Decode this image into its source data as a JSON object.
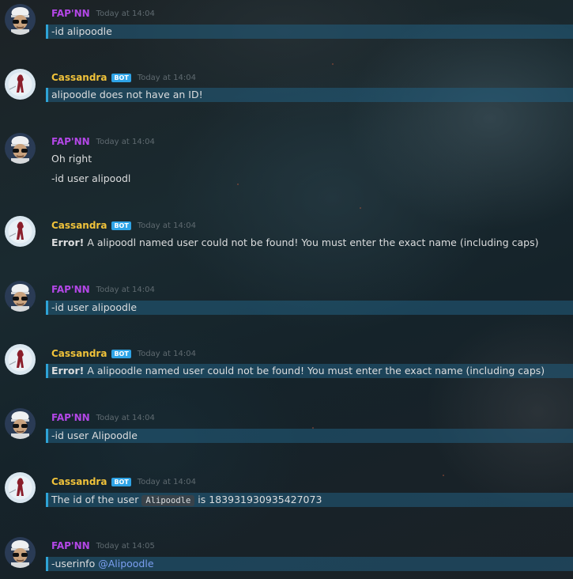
{
  "messages": [
    {
      "author": "FAP'NN",
      "bot": false,
      "timestamp": "Today at 14:04",
      "lines": [
        "-id alipoodle"
      ],
      "highlight": true
    },
    {
      "author": "Cassandra",
      "bot": true,
      "timestamp": "Today at 14:04",
      "lines": [
        "alipoodle does not have an ID!"
      ],
      "highlight": true
    },
    {
      "author": "FAP'NN",
      "bot": false,
      "timestamp": "Today at 14:04",
      "lines": [
        "Oh right",
        "-id user alipoodl"
      ],
      "highlight": false
    },
    {
      "author": "Cassandra",
      "bot": true,
      "timestamp": "Today at 14:04",
      "error_label": "Error!",
      "error_text": "A alipoodl named user could not be found! You must enter the exact name (including caps)",
      "highlight": false
    },
    {
      "author": "FAP'NN",
      "bot": false,
      "timestamp": "Today at 14:04",
      "lines": [
        "-id user alipoodle"
      ],
      "highlight": true
    },
    {
      "author": "Cassandra",
      "bot": true,
      "timestamp": "Today at 14:04",
      "error_label": "Error!",
      "error_text": "A alipoodle named user could not be found! You must enter the exact name (including caps)",
      "highlight": true
    },
    {
      "author": "FAP'NN",
      "bot": false,
      "timestamp": "Today at 14:04",
      "lines": [
        "-id user Alipoodle"
      ],
      "highlight": true
    },
    {
      "author": "Cassandra",
      "bot": true,
      "timestamp": "Today at 14:04",
      "id_prefix": "The id of the user",
      "id_code": "Alipoodle",
      "id_suffix": "is 183931930935427073",
      "highlight": true
    },
    {
      "author": "FAP'NN",
      "bot": false,
      "timestamp": "Today at 14:05",
      "command": "-userinfo",
      "mention": "@Alipoodle",
      "highlight": true
    }
  ],
  "bot_tag": "BOT",
  "colors": {
    "user_name": "#b347e6",
    "bot_name": "#f0c23a",
    "bot_tag": "#2fa4e7",
    "highlight_bar": "#2ea3d6",
    "mention": "#7b9ff0"
  },
  "icons": {
    "user_avatar": "sunglasses-cap-avatar-icon",
    "bot_avatar": "cassandra-silhouette-avatar-icon"
  }
}
